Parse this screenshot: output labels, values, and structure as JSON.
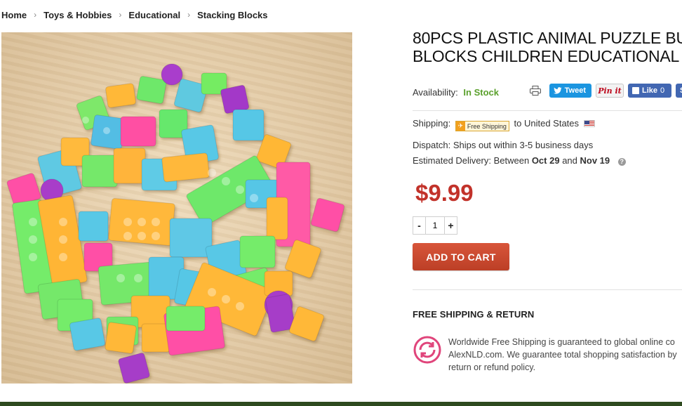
{
  "breadcrumb": {
    "items": [
      "Home",
      "Toys & Hobbies",
      "Educational",
      "Stacking Blocks"
    ],
    "separator": "›"
  },
  "product": {
    "title_line1": "80PCS PLASTIC ANIMAL PUZZLE BU",
    "title_line2": "BLOCKS CHILDREN EDUCATIONAL T",
    "availability_label": "Availability:",
    "availability_value": "In Stock",
    "price": "$9.99",
    "quantity": "1",
    "image_alt": "Colorful plastic building blocks on wooden surface"
  },
  "social": {
    "tweet": "Tweet",
    "pin": "Pin it",
    "like": "Like",
    "like_count": "0",
    "share": "Sh"
  },
  "shipping": {
    "label": "Shipping:",
    "badge": "Free Shipping",
    "destination": "to United States"
  },
  "dispatch": {
    "label": "Dispatch:",
    "value": "Ships out within 3-5 business days"
  },
  "delivery": {
    "label": "Estimated Delivery: Between",
    "start": "Oct 29",
    "and": "and",
    "end": "Nov 19",
    "help": "?"
  },
  "qty_controls": {
    "minus": "-",
    "plus": "+"
  },
  "cart": {
    "button_label": "ADD TO CART"
  },
  "free_return": {
    "heading": "FREE SHIPPING & RETURN",
    "line1": "Worldwide Free Shipping is guaranteed to global online co",
    "line2": "AlexNLD.com. We guarantee total shopping satisfaction by",
    "line3": "return or refund policy."
  },
  "colors": {
    "price": "#c2322a",
    "in_stock": "#5aa02c",
    "cart_button": "#c7482e",
    "return_icon": "#e0457b"
  }
}
